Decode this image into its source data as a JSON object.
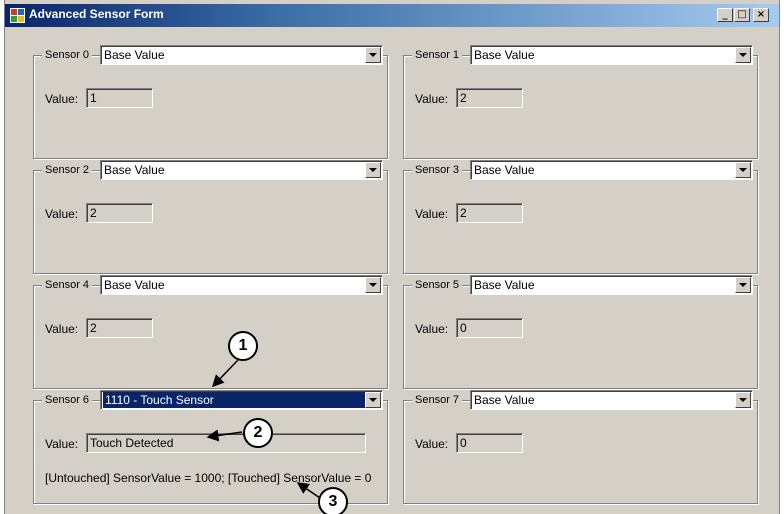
{
  "window": {
    "title": "Advanced Sensor Form",
    "controls": {
      "minimize": "_",
      "maximize": "□",
      "close": "×"
    }
  },
  "sensors": [
    {
      "label": "Sensor 0",
      "selection": "Base Value",
      "value_label": "Value:",
      "value": "1"
    },
    {
      "label": "Sensor 1",
      "selection": "Base Value",
      "value_label": "Value:",
      "value": "2"
    },
    {
      "label": "Sensor 2",
      "selection": "Base Value",
      "value_label": "Value:",
      "value": "2"
    },
    {
      "label": "Sensor 3",
      "selection": "Base Value",
      "value_label": "Value:",
      "value": "2"
    },
    {
      "label": "Sensor 4",
      "selection": "Base Value",
      "value_label": "Value:",
      "value": "2"
    },
    {
      "label": "Sensor 5",
      "selection": "Base Value",
      "value_label": "Value:",
      "value": "0"
    },
    {
      "label": "Sensor 6",
      "selection": "1110 - Touch Sensor",
      "value_label": "Value:",
      "value": "Touch Detected",
      "hint": "[Untouched] SensorValue = 1000; [Touched] SensorValue = 0"
    },
    {
      "label": "Sensor 7",
      "selection": "Base Value",
      "value_label": "Value:",
      "value": "0"
    }
  ],
  "callouts": [
    "1",
    "2",
    "3"
  ],
  "colors": {
    "face": "#d4d0c8",
    "title_start": "#0a246a",
    "title_end": "#a6caf0",
    "selection": "#0a246a"
  }
}
